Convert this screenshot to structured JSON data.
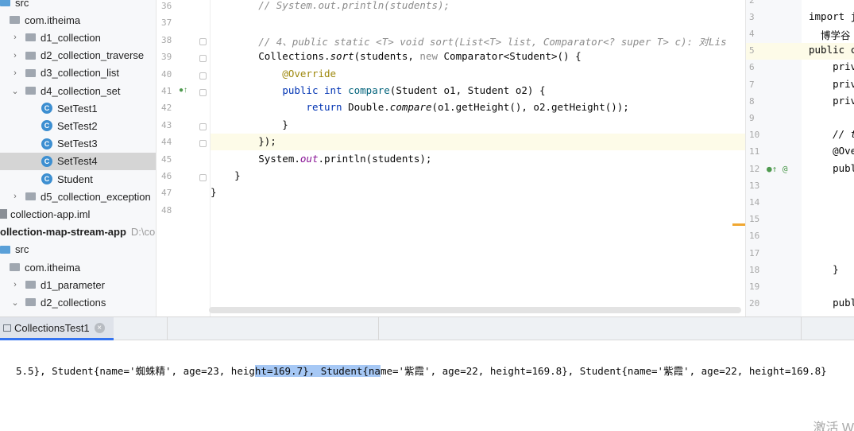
{
  "project_tree": {
    "rows": [
      {
        "label": "src",
        "kind": "src-folder",
        "indent": 0,
        "chevron": ""
      },
      {
        "label": "com.itheima",
        "kind": "package",
        "indent": 1,
        "chevron": ""
      },
      {
        "label": "d1_collection",
        "kind": "folder",
        "indent": 2,
        "chevron": "›"
      },
      {
        "label": "d2_collection_traverse",
        "kind": "folder",
        "indent": 2,
        "chevron": "›"
      },
      {
        "label": "d3_collection_list",
        "kind": "folder",
        "indent": 2,
        "chevron": "›"
      },
      {
        "label": "d4_collection_set",
        "kind": "folder",
        "indent": 2,
        "chevron": "⌄"
      },
      {
        "label": "SetTest1",
        "kind": "class",
        "indent": 3,
        "chevron": ""
      },
      {
        "label": "SetTest2",
        "kind": "class",
        "indent": 3,
        "chevron": ""
      },
      {
        "label": "SetTest3",
        "kind": "class",
        "indent": 3,
        "chevron": ""
      },
      {
        "label": "SetTest4",
        "kind": "class",
        "indent": 3,
        "chevron": "",
        "selected": true
      },
      {
        "label": "Student",
        "kind": "class",
        "indent": 3,
        "chevron": ""
      },
      {
        "label": "d5_collection_exception",
        "kind": "folder",
        "indent": 2,
        "chevron": "›"
      },
      {
        "label": "collection-app.iml",
        "kind": "iml",
        "indent": 0,
        "chevron": ""
      },
      {
        "label": "ollection-map-stream-app",
        "kind": "module",
        "indent": 0,
        "chevron": "",
        "path": "D:\\co"
      },
      {
        "label": "src",
        "kind": "src-folder",
        "indent": 0,
        "chevron": ""
      },
      {
        "label": "com.itheima",
        "kind": "package",
        "indent": 1,
        "chevron": ""
      },
      {
        "label": "d1_parameter",
        "kind": "folder",
        "indent": 2,
        "chevron": "›"
      },
      {
        "label": "d2_collections",
        "kind": "folder",
        "indent": 2,
        "chevron": "⌄"
      }
    ]
  },
  "editor": {
    "line_numbers": [
      "36",
      "37",
      "38",
      "39",
      "40",
      "41",
      "42",
      "43",
      "44",
      "45",
      "46",
      "47",
      "48"
    ],
    "lines": [
      {
        "parts": [
          {
            "t": "        // System.out.println(students);",
            "c": "cm"
          }
        ]
      },
      {
        "parts": []
      },
      {
        "parts": [
          {
            "t": "        // 4、public static <T> void sort(List<T> list, Comparator<? super T> c): 对Lis",
            "c": "cm"
          }
        ]
      },
      {
        "parts": [
          {
            "t": "        Collections.",
            "c": ""
          },
          {
            "t": "sort",
            "c": "it"
          },
          {
            "t": "(students, ",
            "c": ""
          },
          {
            "t": "new",
            "c": "gray"
          },
          {
            "t": " Comparator<Student>() {",
            "c": ""
          }
        ]
      },
      {
        "parts": [
          {
            "t": "            @Override",
            "c": "an"
          }
        ]
      },
      {
        "parts": [
          {
            "t": "            ",
            "c": ""
          },
          {
            "t": "public int",
            "c": "kw"
          },
          {
            "t": " ",
            "c": ""
          },
          {
            "t": "compare",
            "c": "fn"
          },
          {
            "t": "(Student o1, Student o2) {",
            "c": ""
          }
        ]
      },
      {
        "parts": [
          {
            "t": "                ",
            "c": ""
          },
          {
            "t": "return",
            "c": "kw"
          },
          {
            "t": " Double.",
            "c": ""
          },
          {
            "t": "compare",
            "c": "it"
          },
          {
            "t": "(o1.getHeight(), o2.getHeight());",
            "c": ""
          }
        ]
      },
      {
        "parts": [
          {
            "t": "            }",
            "c": ""
          }
        ]
      },
      {
        "parts": [
          {
            "t": "        });",
            "c": ""
          }
        ]
      },
      {
        "parts": [
          {
            "t": "        System.",
            "c": ""
          },
          {
            "t": "out",
            "c": "st"
          },
          {
            "t": ".println(students);",
            "c": ""
          }
        ]
      },
      {
        "parts": [
          {
            "t": "    }",
            "c": ""
          }
        ]
      },
      {
        "parts": [
          {
            "t": "}",
            "c": ""
          }
        ]
      },
      {
        "parts": []
      }
    ]
  },
  "right_editor": {
    "line_numbers": [
      "2",
      "3",
      "4",
      "5",
      "6",
      "7",
      "8",
      "9",
      "10",
      "11",
      "12",
      "13",
      "14",
      "15",
      "16",
      "17",
      "18",
      "19",
      "20"
    ],
    "lines": [
      {
        "t": "",
        "c": ""
      },
      {
        "t": "import j",
        "c": "kw"
      },
      {
        "t": "  博学谷",
        "c": "gray"
      },
      {
        "t": "public c",
        "c": "kw"
      },
      {
        "t": "    priv",
        "c": "kw"
      },
      {
        "t": "    priv",
        "c": "kw"
      },
      {
        "t": "    priv",
        "c": "kw"
      },
      {
        "t": "",
        "c": ""
      },
      {
        "t": "    // t",
        "c": "cm"
      },
      {
        "t": "    @Ove",
        "c": "an"
      },
      {
        "t": "    publ",
        "c": "kw"
      },
      {
        "t": "",
        "c": ""
      },
      {
        "t": "",
        "c": ""
      },
      {
        "t": "",
        "c": ""
      },
      {
        "t": "",
        "c": ""
      },
      {
        "t": "",
        "c": ""
      },
      {
        "t": "    }",
        "c": ""
      },
      {
        "t": "",
        "c": ""
      },
      {
        "t": "    publ",
        "c": "kw"
      }
    ],
    "gutter_marks": "●↑ @"
  },
  "run_window": {
    "tab_label": "CollectionsTest1",
    "close_glyph": "×",
    "output_before": "5.5}, Student{name='蜘蛛精', age=23, heig",
    "output_selected": "ht=169.7}, Student{na",
    "output_after": "me='紫霞', age=22, height=169.8}, Student{name='紫霞', age=22, height=169.8}",
    "watermark": "激活 W"
  },
  "icons": {
    "chevron_right": "›",
    "chevron_down": "⌄",
    "class_letter": "C",
    "run_gutter": "●↑"
  },
  "colors": {
    "keyword": "#0033b3",
    "comment": "#8c8c8c",
    "annotation": "#9e880d",
    "selection": "#a6c8f5",
    "tab_underline": "#3574f0"
  }
}
